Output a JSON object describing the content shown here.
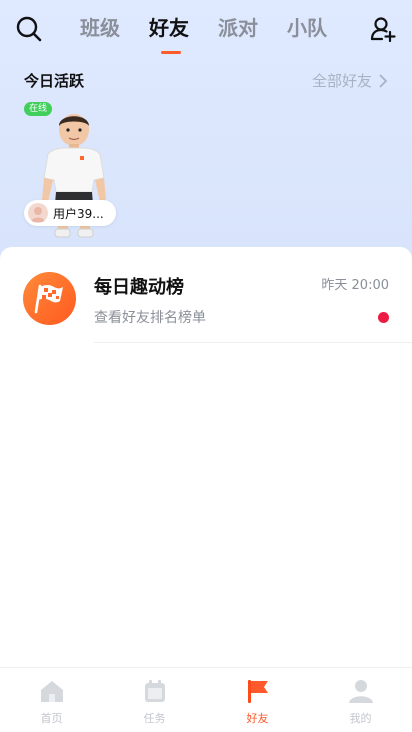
{
  "header": {
    "tabs": [
      {
        "label": "班级",
        "active": false
      },
      {
        "label": "好友",
        "active": true
      },
      {
        "label": "派对",
        "active": false
      },
      {
        "label": "小队",
        "active": false
      }
    ],
    "icons": {
      "search": "search-icon",
      "add_friend": "add-friend-icon"
    }
  },
  "today_active": {
    "title": "今日活跃",
    "all_friends_label": "全部好友",
    "friends": [
      {
        "status": "在线",
        "name": "用户39..."
      }
    ]
  },
  "list": {
    "items": [
      {
        "title": "每日趣动榜",
        "subtitle": "查看好友排名榜单",
        "time": "昨天 20:00",
        "unread": true
      }
    ]
  },
  "bottom_nav": {
    "items": [
      {
        "label": "首页",
        "icon": "home-icon",
        "active": false
      },
      {
        "label": "任务",
        "icon": "calendar-icon",
        "active": false
      },
      {
        "label": "好友",
        "icon": "flag-icon",
        "active": true
      },
      {
        "label": "我的",
        "icon": "person-icon",
        "active": false
      }
    ]
  },
  "colors": {
    "accent": "#ff5a2c",
    "online": "#3fcf5a",
    "unread_dot": "#ee1a45",
    "top_background": "#dfe9ff"
  }
}
